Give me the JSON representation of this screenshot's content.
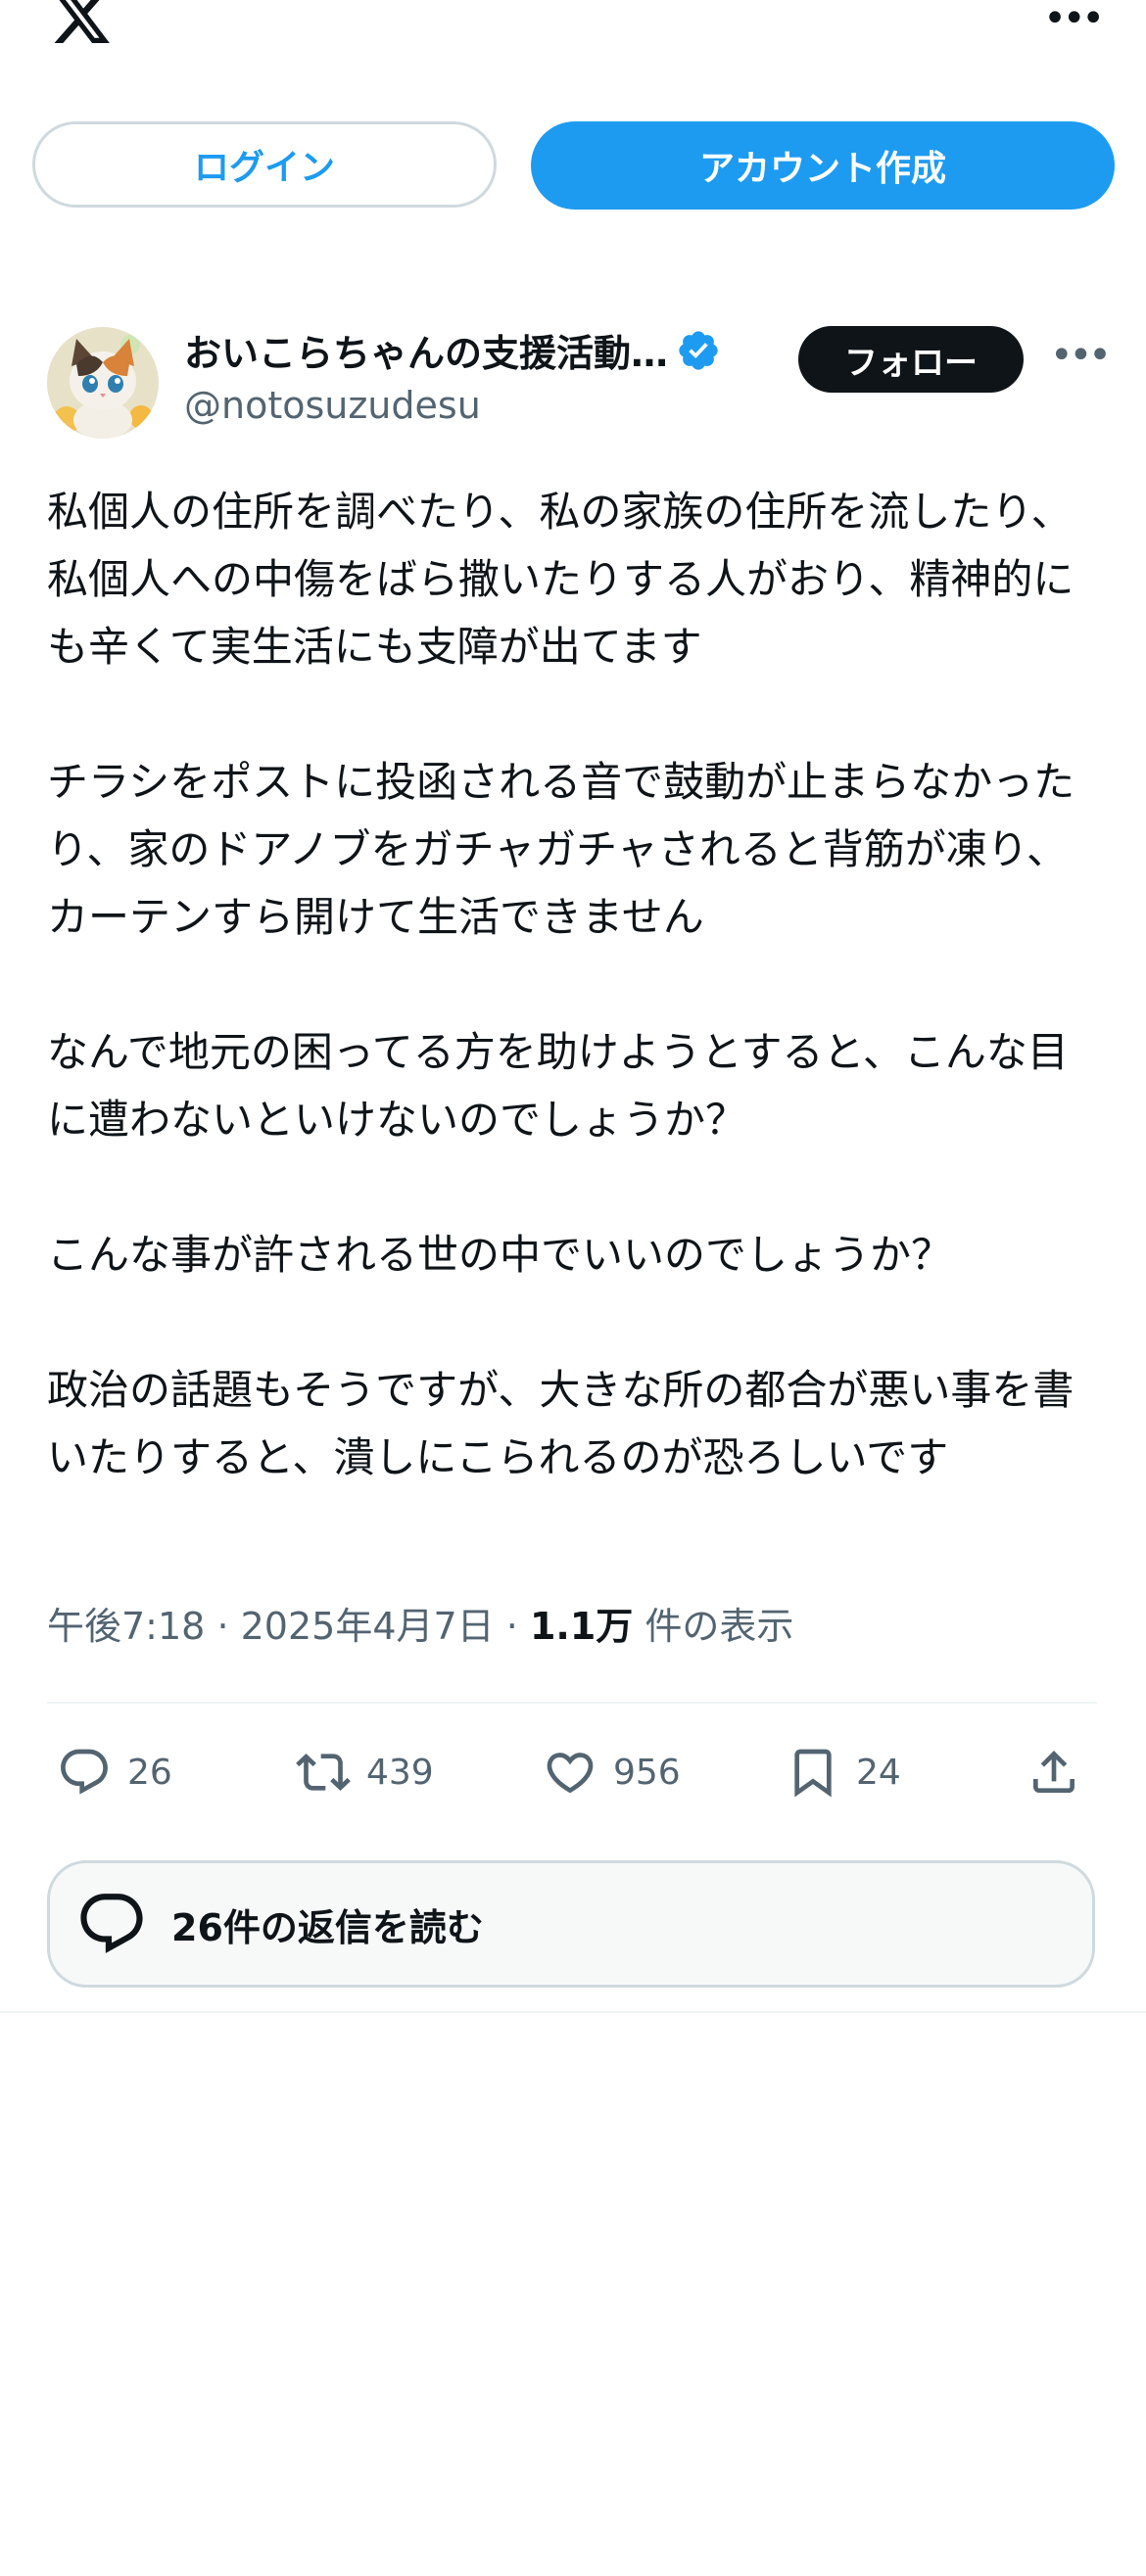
{
  "header": {
    "logo_icon": "x-logo-icon",
    "more_icon": "more-horizontal-icon",
    "login_label": "ログイン",
    "signup_label": "アカウント作成"
  },
  "post": {
    "author_name": "おいこらちゃんの支援活動…",
    "handle": "@notosuzudesu",
    "verified": true,
    "follow_label": "フォロー",
    "paragraphs": [
      "私個人の住所を調べたり、私の家族の住所を流したり、私個人への中傷をばら撒いたりする人がおり、精神的にも辛くて実生活にも支障が出てます",
      "チラシをポストに投函される音で鼓動が止まらなかったり、家のドアノブをガチャガチャされると背筋が凍り、カーテンすら開けて生活できません",
      "なんで地元の困ってる方を助けようとすると、こんな目に遭わないといけないのでしょうか？",
      "こんな事が許される世の中でいいのでしょうか？",
      "政治の話題もそうですが、大きな所の都合が悪い事を書いたりすると、潰しにこられるのが恐ろしいです"
    ],
    "time": "午後7:18",
    "date": "2025年4月7日",
    "views_count": "1.1万",
    "views_label": "件の表示",
    "separator": "·"
  },
  "actions": {
    "replies": "26",
    "reposts": "439",
    "likes": "956",
    "bookmarks": "24"
  },
  "read_replies_label": "26件の返信を読む",
  "colors": {
    "accent": "#1d9bf0",
    "text": "#0f1419",
    "secondary": "#536471",
    "border": "#cfd9de"
  }
}
